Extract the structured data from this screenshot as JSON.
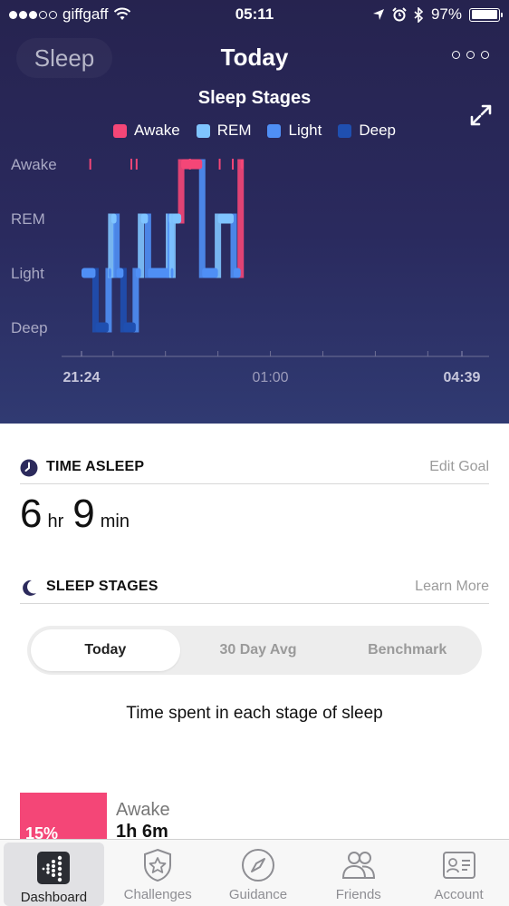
{
  "status_bar": {
    "carrier": "giffgaff",
    "time": "05:11",
    "battery": "97%",
    "battery_level": 0.97
  },
  "nav": {
    "back_label": "Sleep",
    "title": "Today"
  },
  "chart_data": {
    "type": "line",
    "title": "Sleep Stages",
    "stages": [
      "Awake",
      "REM",
      "Light",
      "Deep"
    ],
    "legend": [
      {
        "name": "Awake",
        "color": "#f44677"
      },
      {
        "name": "REM",
        "color": "#7fc4ff"
      },
      {
        "name": "Light",
        "color": "#4f8ff5"
      },
      {
        "name": "Deep",
        "color": "#1f4fb0"
      }
    ],
    "x_tick_labels": [
      "21:24",
      "01:00",
      "04:39"
    ],
    "x_range": [
      "21:24",
      "04:39"
    ],
    "segments": [
      {
        "stage": "Light",
        "start": "21:24",
        "end": "21:40"
      },
      {
        "stage": "Deep",
        "start": "21:40",
        "end": "21:55"
      },
      {
        "stage": "Light",
        "start": "21:55",
        "end": "21:58"
      },
      {
        "stage": "REM",
        "start": "21:58",
        "end": "22:04"
      },
      {
        "stage": "Light",
        "start": "22:04",
        "end": "22:12"
      },
      {
        "stage": "Deep",
        "start": "22:12",
        "end": "22:26"
      },
      {
        "stage": "Light",
        "start": "22:26",
        "end": "22:32"
      },
      {
        "stage": "REM",
        "start": "22:32",
        "end": "22:40"
      },
      {
        "stage": "Light",
        "start": "22:40",
        "end": "23:04"
      },
      {
        "stage": "REM",
        "start": "23:04",
        "end": "23:06"
      },
      {
        "stage": "Light",
        "start": "23:06",
        "end": "23:08"
      },
      {
        "stage": "REM",
        "start": "23:08",
        "end": "23:18"
      },
      {
        "stage": "Awake",
        "start": "23:18",
        "end": "23:42"
      },
      {
        "stage": "Light",
        "start": "23:42",
        "end": "24:00"
      },
      {
        "stage": "REM",
        "start": "24:00",
        "end": "24:18"
      },
      {
        "stage": "Light",
        "start": "24:18",
        "end": "24:26"
      },
      {
        "stage": "Awake",
        "start": "24:26",
        "end": "24:28"
      }
    ],
    "awake_ticks": [
      "21:34",
      "22:21",
      "22:27",
      "23:28",
      "24:02",
      "24:17"
    ]
  },
  "time_asleep": {
    "heading": "TIME ASLEEP",
    "link": "Edit Goal",
    "hours": "6",
    "hours_unit": "hr",
    "minutes": "9",
    "minutes_unit": "min"
  },
  "sleep_stages": {
    "heading": "SLEEP STAGES",
    "link": "Learn More",
    "tabs": [
      "Today",
      "30 Day Avg",
      "Benchmark"
    ],
    "caption": "Time spent in each stage of sleep",
    "rows": [
      {
        "percent": "15%",
        "name": "Awake",
        "duration": "1h 6m",
        "percent_value": 15
      }
    ]
  },
  "tabbar": {
    "items": [
      {
        "label": "Dashboard",
        "icon": "dashboard-icon"
      },
      {
        "label": "Challenges",
        "icon": "challenges-icon"
      },
      {
        "label": "Guidance",
        "icon": "compass-icon"
      },
      {
        "label": "Friends",
        "icon": "friends-icon"
      },
      {
        "label": "Account",
        "icon": "account-icon"
      }
    ]
  }
}
